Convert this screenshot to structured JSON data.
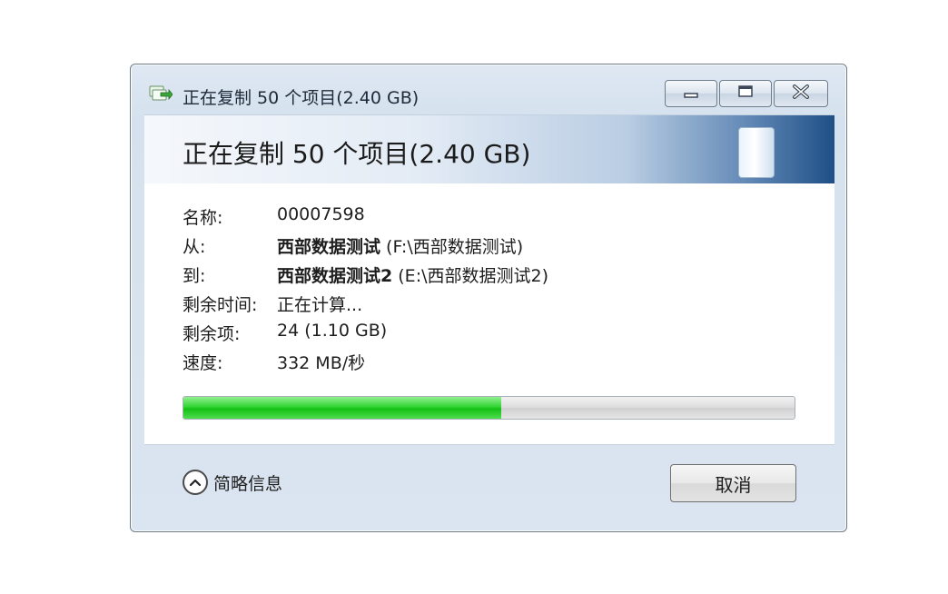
{
  "window": {
    "title": "正在复制 50 个项目(2.40 GB)",
    "icons": {
      "app": "copy-arrow-icon",
      "minimize": "minimize-icon",
      "maximize": "maximize-icon",
      "close": "close-icon"
    }
  },
  "header": {
    "title": "正在复制 50 个项目(2.40 GB)",
    "icon": "drive-icon"
  },
  "details": {
    "name_label": "名称:",
    "name_value": "00007598",
    "from_label": "从:",
    "from_bold": "西部数据测试",
    "from_path": " (F:\\西部数据测试)",
    "to_label": "到:",
    "to_bold": "西部数据测试2",
    "to_path": " (E:\\西部数据测试2)",
    "time_label": "剩余时间:",
    "time_value": "正在计算...",
    "items_label": "剩余项:",
    "items_value": "24 (1.10 GB)",
    "speed_label": "速度:",
    "speed_value": "332 MB/秒"
  },
  "progress": {
    "percent": 52,
    "color": "#22c822"
  },
  "footer": {
    "toggle_label": "简略信息",
    "toggle_icon": "chevron-up-icon",
    "cancel_label": "取消"
  }
}
